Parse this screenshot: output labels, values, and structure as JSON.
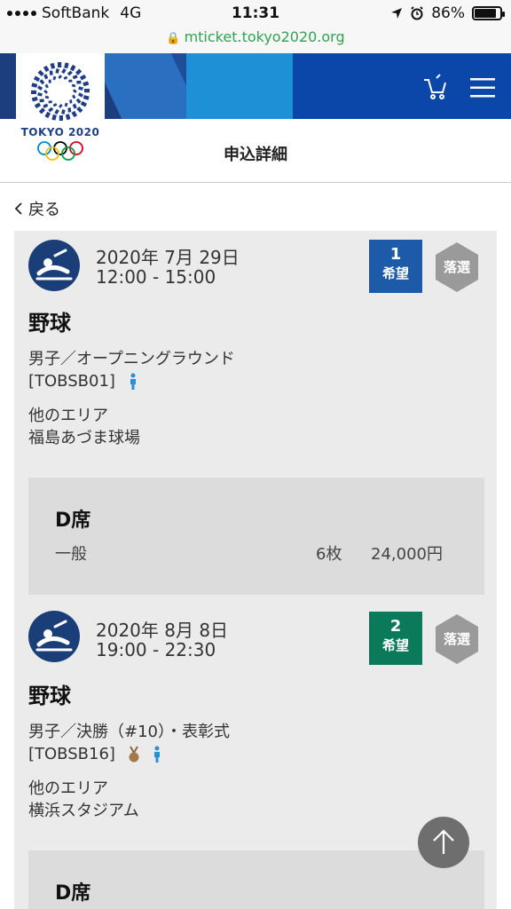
{
  "status_bar": {
    "carrier": "SoftBank",
    "network": "4G",
    "time": "11:31",
    "battery": "86%",
    "battery_level": 0.86
  },
  "url": "mticket.tokyo2020.org",
  "header": {
    "logo_text": "TOKYO 2020",
    "title": "申込詳細"
  },
  "nav": {
    "back_label": "戻る"
  },
  "applications": [
    {
      "date": "2020年 7月 29日",
      "time": "12:00 - 15:00",
      "rank_number": "1",
      "rank_label": "希望",
      "rank_color": "#1d5aa8",
      "result": "落選",
      "sport": "野球",
      "event": "男子／オープニングラウンド",
      "code": "[TOBSB01]",
      "area": "他のエリア",
      "venue": "福島あづま球場",
      "seat_name": "D席",
      "ticket_type": "一般",
      "quantity": "6枚",
      "price": "24,000円"
    },
    {
      "date": "2020年 8月 8日",
      "time": "19:00 - 22:30",
      "rank_number": "2",
      "rank_label": "希望",
      "rank_color": "#0b7a5a",
      "result": "落選",
      "sport": "野球",
      "event": "男子／決勝（#10）・表彰式",
      "code": "[TOBSB16]",
      "area": "他のエリア",
      "venue": "横浜スタジアム",
      "seat_name": "D席"
    }
  ],
  "colors": {
    "result_badge": "#9a9a9a",
    "card_bg": "#ebebeb",
    "sport_icon_bg": "#1a3f78",
    "url_green": "#2fa44f"
  }
}
